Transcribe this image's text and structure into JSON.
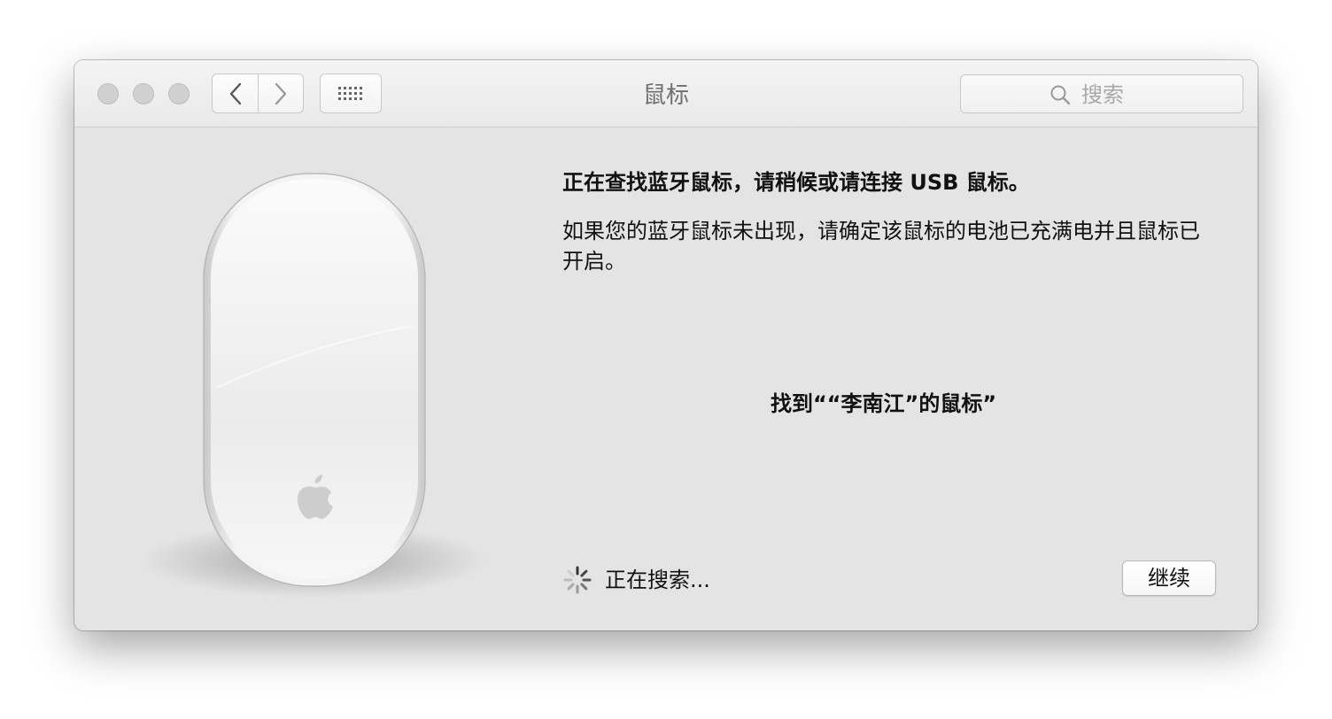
{
  "window": {
    "title": "鼠标"
  },
  "toolbar": {
    "back_icon": "chevron-left-icon",
    "forward_icon": "chevron-right-icon",
    "grid_icon": "grid-icon",
    "search_placeholder": "搜索"
  },
  "content": {
    "heading": "正在查找蓝牙鼠标，请稍候或请连接 USB 鼠标。",
    "description": "如果您的蓝牙鼠标未出现，请确定该鼠标的电池已充满电并且鼠标已开启。",
    "found_device": "找到““李南江”的鼠标”",
    "status": "正在搜索...",
    "continue_label": "继续"
  },
  "colors": {
    "window_bg": "#e4e4e4",
    "titlebar_bg": "#efefef",
    "traffic_light_inactive": "#d0d0d0"
  }
}
